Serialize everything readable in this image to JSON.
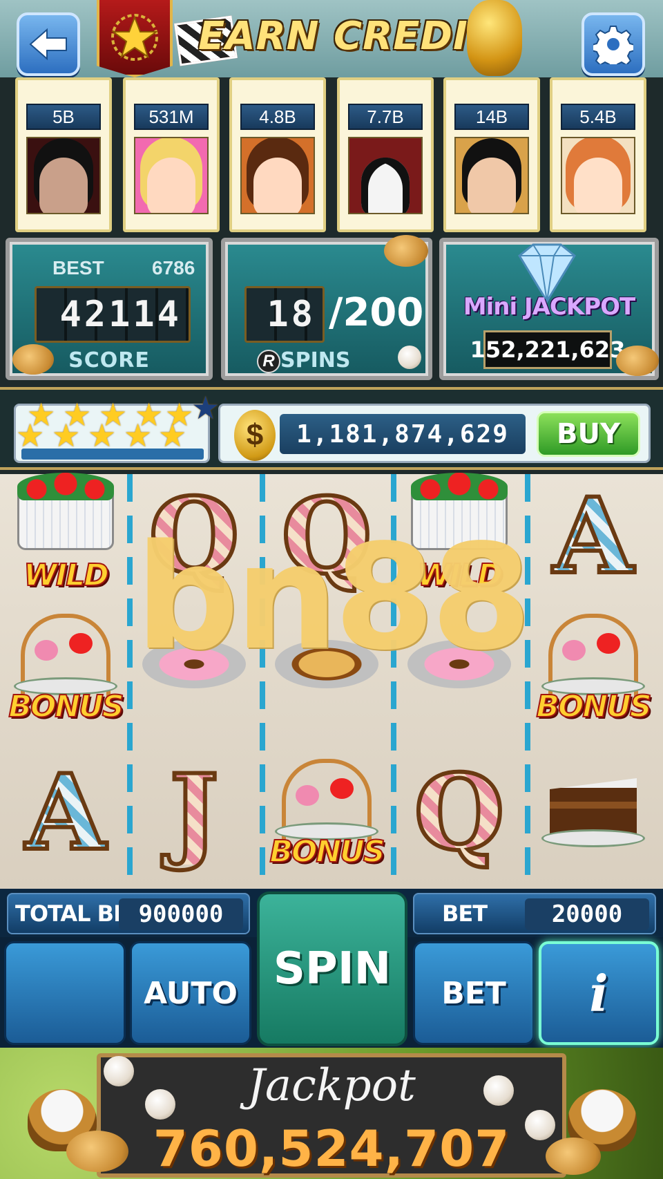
{
  "header": {
    "back_icon": "arrow-left-icon",
    "title": "EARN CREDIT",
    "settings_icon": "gear-icon",
    "rank_icon": "star-icon"
  },
  "players": [
    {
      "amount": "5B",
      "avatar": "vampire-man",
      "color": "#7a2d2d"
    },
    {
      "amount": "531M",
      "avatar": "blonde-woman",
      "color": "#f1c36a"
    },
    {
      "amount": "4.8B",
      "avatar": "flower-girl",
      "color": "#c74a2a"
    },
    {
      "amount": "7.7B",
      "avatar": "panda",
      "color": "#eeeeee"
    },
    {
      "amount": "14B",
      "avatar": "cap-boy",
      "color": "#2a3a5a"
    },
    {
      "amount": "5.4B",
      "avatar": "red-haired-girl",
      "color": "#e07a3a"
    }
  ],
  "score_panel": {
    "best_label": "BEST",
    "best_value": "6786",
    "score_value": "42114",
    "label": "SCORE"
  },
  "spins_panel": {
    "current": "18",
    "total": "/200",
    "logo": "R",
    "label": "SPINS"
  },
  "mini_jackpot": {
    "title": "Mini JACKPOT",
    "value": "152,221,623"
  },
  "level": {
    "stars_filled": 10,
    "stars_total": 11
  },
  "balance": {
    "coin_symbol": "$",
    "value": "1,181,874,629",
    "buy_label": "BUY"
  },
  "reels": {
    "columns": [
      [
        "wild-cake",
        "bonus-tier",
        "letter-A"
      ],
      [
        "letter-Q",
        "donut",
        "letter-J"
      ],
      [
        "letter-Q",
        "pancake",
        "bonus-tier"
      ],
      [
        "wild-cake",
        "donut",
        "letter-Q"
      ],
      [
        "letter-A",
        "bonus-tier",
        "choc-cake"
      ]
    ],
    "wild_label": "WILD",
    "bonus_label": "BONUS",
    "letters": {
      "a": "A",
      "q": "Q",
      "j": "J"
    }
  },
  "watermark": "bn88",
  "bets": {
    "total_bet_label": "TOTAL BET",
    "total_bet_value": "900000",
    "bet_label": "BET",
    "bet_value": "20000"
  },
  "controls": {
    "spin_label": "SPIN",
    "auto_label": "AUTO",
    "bet_button_label": "BET",
    "info_label": "i"
  },
  "jackpot": {
    "title": "Jackpot",
    "value": "760,524,707"
  },
  "colors": {
    "accent_gold": "#ffe27a",
    "button_blue": "#2d6fc0",
    "spin_green": "#167a62",
    "buy_green": "#2f9a26",
    "jackpot_orange": "#ffb347"
  }
}
